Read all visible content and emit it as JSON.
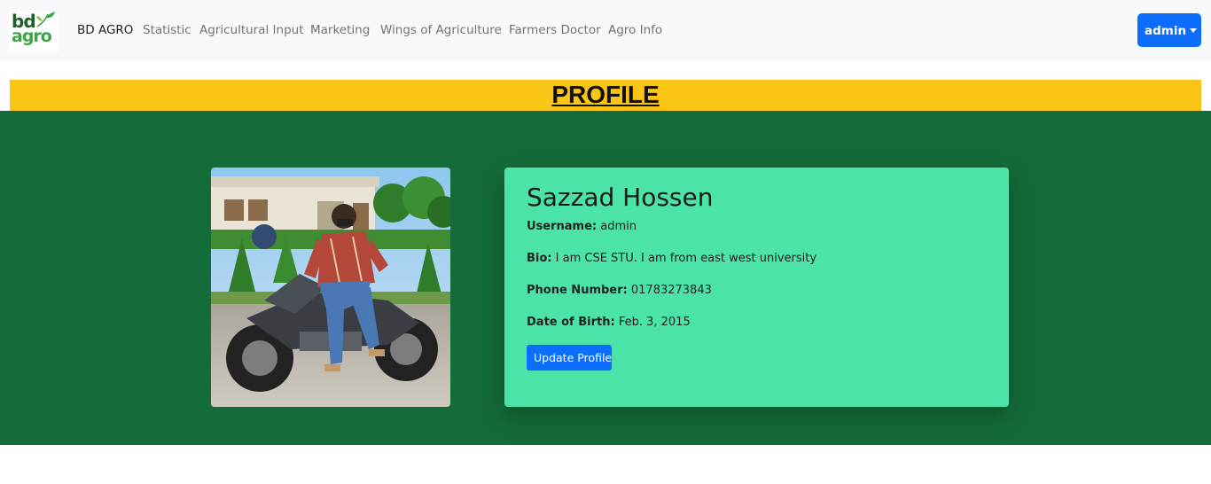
{
  "navbar": {
    "logo_text_top": "bd",
    "logo_text_bottom": "agro",
    "brand": "BD AGRO",
    "links": [
      "Statistic",
      "Agricultural Input",
      "Marketing",
      "Wings of Agriculture",
      "Farmers Doctor",
      "Agro Info"
    ],
    "user_menu_label": "admin"
  },
  "page": {
    "title": "PROFILE"
  },
  "profile": {
    "full_name": "Sazzad Hossen",
    "username_label": "Username:",
    "username": "admin",
    "bio_label": "Bio:",
    "bio": "I am CSE STU. I am from east west university",
    "phone_label": "Phone Number:",
    "phone": "01783273843",
    "dob_label": "Date of Birth:",
    "dob": "Feb. 3, 2015",
    "update_button": "Update Profile"
  },
  "colors": {
    "navbar_bg": "#f8f9fa",
    "primary": "#0d6efd",
    "title_bg": "#fbc516",
    "section_bg": "#146c3a",
    "card_bg": "#4ce3a8"
  }
}
